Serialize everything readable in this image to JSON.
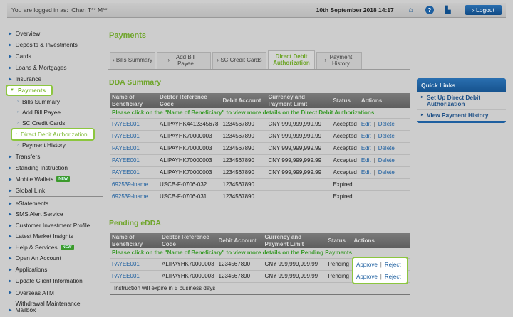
{
  "topbar": {
    "login_label": "You are logged in as:",
    "user": "Chan T** M**",
    "datetime": "10th September 2018 14:17",
    "logout": "Logout"
  },
  "sidebar": {
    "items": [
      "Overview",
      "Deposits & Investments",
      "Cards",
      "Loans & Mortgages",
      "Insurance",
      "Payments"
    ],
    "sub": [
      "Bills Summary",
      "Add Bill Payee",
      "SC Credit Cards",
      "Direct Debit Authorization",
      "Payment History"
    ],
    "items2": [
      "Transfers",
      "Standing Instruction",
      "Mobile Wallets",
      "Global Link"
    ],
    "items3": [
      "eStatements",
      "SMS Alert Service",
      "Customer Investment Profile",
      "Latest Market Insights",
      "Help & Services",
      "Open An Account",
      "Applications",
      "Update Client Information",
      "Overseas ATM",
      "Withdrawal Maintenance",
      "Mailbox"
    ],
    "new_badge": "NEW"
  },
  "main": {
    "title": "Payments",
    "tabs": [
      "Bills Summary",
      "Add Bill Payee",
      "SC Credit Cards",
      "Direct Debit Authorization",
      "Payment History"
    ],
    "dda": {
      "title": "DDA Summary",
      "headers": [
        "Name of Beneficiary",
        "Debtor Reference Code",
        "Debit Account",
        "Currency and Payment Limit",
        "Status",
        "Actions"
      ],
      "note": "Please click on the \"Name of Beneficiary\" to view more details on the Direct Debit Authorizations",
      "rows": [
        [
          "PAYEE001",
          "ALIPAYHK4412345678",
          "1234567890",
          "CNY 999,999,999.99",
          "Accepted"
        ],
        [
          "PAYEE001",
          "ALIPAYHK70000003",
          "1234567890",
          "CNY 999,999,999.99",
          "Accepted"
        ],
        [
          "PAYEE001",
          "ALIPAYHK70000003",
          "1234567890",
          "CNY 999,999,999.99",
          "Accepted"
        ],
        [
          "PAYEE001",
          "ALIPAYHK70000003",
          "1234567890",
          "CNY 999,999,999.99",
          "Accepted"
        ],
        [
          "PAYEE001",
          "ALIPAYHK70000003",
          "1234567890",
          "CNY 999,999,999.99",
          "Accepted"
        ],
        [
          "692539-lname",
          "USCB-F-0706-032",
          "1234567890",
          "",
          "Expired"
        ],
        [
          "692539-lname",
          "USCB-F-0706-031",
          "1234567890",
          "",
          "Expired"
        ]
      ],
      "edit": "Edit",
      "delete": "Delete"
    },
    "pending": {
      "title": "Pending eDDA",
      "headers": [
        "Name of Beneficiary",
        "Debtor Reference Code",
        "Debit Account",
        "Currency and Payment Limit",
        "Status",
        "Actions"
      ],
      "note": "Please click on the \"Name of Beneficiary\" to view more details on the Pending Payments",
      "rows": [
        [
          "PAYEE001",
          "ALIPAYHK70000003",
          "1234567890",
          "CNY 999,999,999.99",
          "Pending"
        ],
        [
          "PAYEE001",
          "ALIPAYHK70000003",
          "1234567890",
          "CNY 999,999,999.99",
          "Pending"
        ]
      ],
      "approve": "Approve",
      "reject": "Reject",
      "footer": "Instruction will expire in 5 business days"
    }
  },
  "quick_links": {
    "title": "Quick Links",
    "items": [
      "Set Up Direct Debit Authorization",
      "View Payment History"
    ]
  }
}
